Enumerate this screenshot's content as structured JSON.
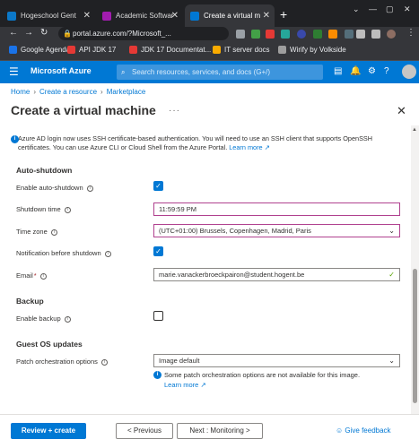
{
  "browser": {
    "tabs": [
      {
        "label": "Hogeschool Gent",
        "icon": "hogent-favicon",
        "color": "#0b78c8"
      },
      {
        "label": "Academic Softwar",
        "icon": "academic-software-favicon",
        "color": "#a21caf"
      },
      {
        "label": "Create a virtual m",
        "icon": "azure-favicon",
        "color": "#0078d4"
      }
    ],
    "new_tab": "+",
    "address": "portal.azure.com/?Microsoft_...",
    "bookmarks": [
      {
        "label": "Google Agenda",
        "icon": "google-agenda-icon",
        "color": "#1a73e8"
      },
      {
        "label": "API JDK 17",
        "icon": "oracle-icon",
        "color": "#e53935"
      },
      {
        "label": "JDK 17 Documentat...",
        "icon": "oracle-icon",
        "color": "#e53935"
      },
      {
        "label": "IT server docs",
        "icon": "folder-icon",
        "color": "#f9ab00"
      },
      {
        "label": "Wirify by Volkside",
        "icon": "wirify-icon",
        "color": "#9e9e9e"
      }
    ]
  },
  "azure": {
    "brand": "Microsoft Azure",
    "search_placeholder": "Search resources, services, and docs (G+/)"
  },
  "breadcrumb": [
    "Home",
    "Create a resource",
    "Marketplace"
  ],
  "page_title": "Create a virtual machine",
  "info_banner": {
    "text": "Azure AD login now uses SSH certificate-based authentication. You will need to use an SSH client that supports OpenSSH certificates. You can use Azure CLI or Cloud Shell from the Azure Portal.",
    "link": "Learn more"
  },
  "auto_shutdown": {
    "heading": "Auto-shutdown",
    "enable_label": "Enable auto-shutdown",
    "enable_checked": true,
    "time_label": "Shutdown time",
    "time_value": "11:59:59 PM",
    "zone_label": "Time zone",
    "zone_value": "(UTC+01:00) Brussels, Copenhagen, Madrid, Paris",
    "notify_label": "Notification before shutdown",
    "notify_checked": true,
    "email_label": "Email",
    "email_required": "*",
    "email_value": "marie.vanackerbroeckpairon@student.hogent.be"
  },
  "backup": {
    "heading": "Backup",
    "enable_label": "Enable backup",
    "enable_checked": false
  },
  "guest_os": {
    "heading": "Guest OS updates",
    "patch_label": "Patch orchestration options",
    "patch_value": "Image default",
    "note": "Some patch orchestration options are not available for this image.",
    "note_link": "Learn more"
  },
  "footer": {
    "review_create": "Review + create",
    "previous": "< Previous",
    "next": "Next : Monitoring >",
    "feedback": "Give feedback"
  },
  "colors": {
    "accent": "#0078d4",
    "required": "#a4262c",
    "focus_border": "#b0418f",
    "valid": "#57a300"
  }
}
